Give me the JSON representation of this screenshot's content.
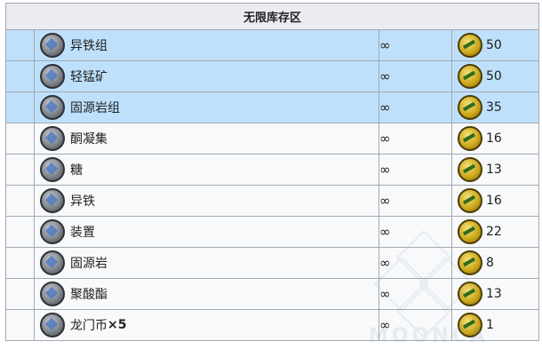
{
  "table": {
    "title": "无限库存区",
    "rows": [
      {
        "name": "异铁组",
        "stock": "∞",
        "cost": "50",
        "icon": "iron-cluster-icon",
        "highlighted": true
      },
      {
        "name": "轻锰矿",
        "stock": "∞",
        "cost": "50",
        "icon": "manganese-ore-icon",
        "highlighted": true
      },
      {
        "name": "固源岩组",
        "stock": "∞",
        "cost": "35",
        "icon": "orirock-cluster-icon",
        "highlighted": true
      },
      {
        "name": "酮凝集",
        "stock": "∞",
        "cost": "16",
        "icon": "ketone-icon",
        "highlighted": false
      },
      {
        "name": "糖",
        "stock": "∞",
        "cost": "13",
        "icon": "sugar-icon",
        "highlighted": false
      },
      {
        "name": "异铁",
        "stock": "∞",
        "cost": "16",
        "icon": "iron-icon",
        "highlighted": false
      },
      {
        "name": "装置",
        "stock": "∞",
        "cost": "22",
        "icon": "device-icon",
        "highlighted": false
      },
      {
        "name": "固源岩",
        "stock": "∞",
        "cost": "8",
        "icon": "orirock-icon",
        "highlighted": false
      },
      {
        "name": "聚酸酯",
        "stock": "∞",
        "cost": "13",
        "icon": "polyester-icon",
        "highlighted": false
      },
      {
        "name": "龙门币",
        "name_suffix": "×5",
        "stock": "∞",
        "cost": "1",
        "icon": "lmd-icon",
        "highlighted": false
      }
    ]
  },
  "currency_icon": "event-token-icon",
  "watermark_text": "MOONCA",
  "colors": {
    "highlight": "#bfe0fb",
    "header": "#eaecf0",
    "border": "#a2a9b1"
  }
}
